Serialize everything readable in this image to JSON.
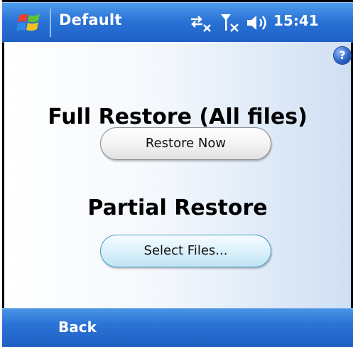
{
  "titlebar": {
    "title": "Default",
    "time": "15:41"
  },
  "icons": {
    "start": "windows-start-flag-icon",
    "connectivity": "connectivity-off-icon",
    "signal": "signal-off-icon",
    "volume": "volume-icon",
    "help": "help-icon"
  },
  "help": {
    "glyph": "?"
  },
  "main": {
    "full_heading": "Full Restore (All files)",
    "restore_button": "Restore Now",
    "partial_heading": "Partial Restore",
    "select_button": "Select Files..."
  },
  "cmdbar": {
    "back_label": "Back"
  },
  "colors": {
    "titlebar": "#2a73d6",
    "cmdbar": "#2b74d6",
    "select_button_fill": "#dcf1fb",
    "select_button_border": "#4b9bc4"
  }
}
